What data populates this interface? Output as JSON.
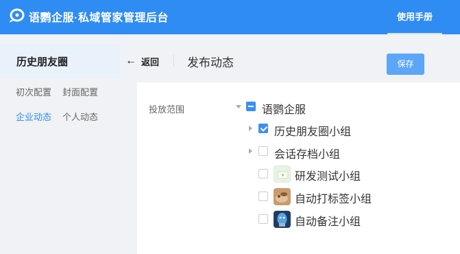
{
  "header": {
    "app_title": "语鹦企服·私域管家管理后台",
    "manual_link": "使用手册"
  },
  "sidebar": {
    "title": "历史朋友圈",
    "items": [
      {
        "label": "初次配置"
      },
      {
        "label": "封面配置"
      },
      {
        "label": "企业动态",
        "active": true
      },
      {
        "label": "个人动态"
      }
    ]
  },
  "toolbar": {
    "back_label": "返回",
    "page_title": "发布动态",
    "save_label": "保存"
  },
  "form": {
    "scope_label": "投放范围",
    "tree": {
      "root": {
        "label": "语鹦企服",
        "state": "indeterminate",
        "expanded": true
      },
      "children": [
        {
          "label": "历史朋友圈小组",
          "checked": true,
          "expandable": true,
          "avatar": false
        },
        {
          "label": "会话存档小组",
          "checked": false,
          "expandable": true,
          "avatar": false
        },
        {
          "label": "研发测试小组",
          "checked": false,
          "expandable": false,
          "avatar": true
        },
        {
          "label": "自动打标签小组",
          "checked": false,
          "expandable": false,
          "avatar": true
        },
        {
          "label": "自动备注小组",
          "checked": false,
          "expandable": false,
          "avatar": true
        }
      ]
    }
  },
  "colors": {
    "primary": "#2f8cf2",
    "sidebar_active_bg": "#e9f1fb",
    "save_button": "#5ca6f7"
  }
}
